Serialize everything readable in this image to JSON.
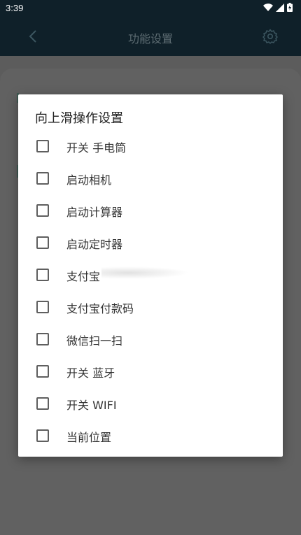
{
  "status_bar": {
    "time": "3:39",
    "icons": [
      "wifi-icon",
      "signal-icon",
      "battery-icon"
    ]
  },
  "app_bar": {
    "title": "功能设置",
    "back_icon": "chevron-left-icon",
    "settings_icon": "gear-icon"
  },
  "dialog": {
    "title": "向上滑操作设置",
    "options": [
      {
        "label": "开关 手电筒",
        "checked": false
      },
      {
        "label": "启动相机",
        "checked": false
      },
      {
        "label": "启动计算器",
        "checked": false
      },
      {
        "label": "启动定时器",
        "checked": false
      },
      {
        "label": "支付宝",
        "checked": false
      },
      {
        "label": "支付宝付款码",
        "checked": false
      },
      {
        "label": "微信扫一扫",
        "checked": false
      },
      {
        "label": "开关 蓝牙",
        "checked": false
      },
      {
        "label": "开关 WIFI",
        "checked": false
      },
      {
        "label": "当前位置",
        "checked": false
      }
    ]
  },
  "colors": {
    "app_bar_bg": "#0f2029",
    "scrim_bg": "#616161",
    "dialog_bg": "#ffffff",
    "text_primary": "#212121",
    "checkbox_border": "#5f5f5f"
  }
}
